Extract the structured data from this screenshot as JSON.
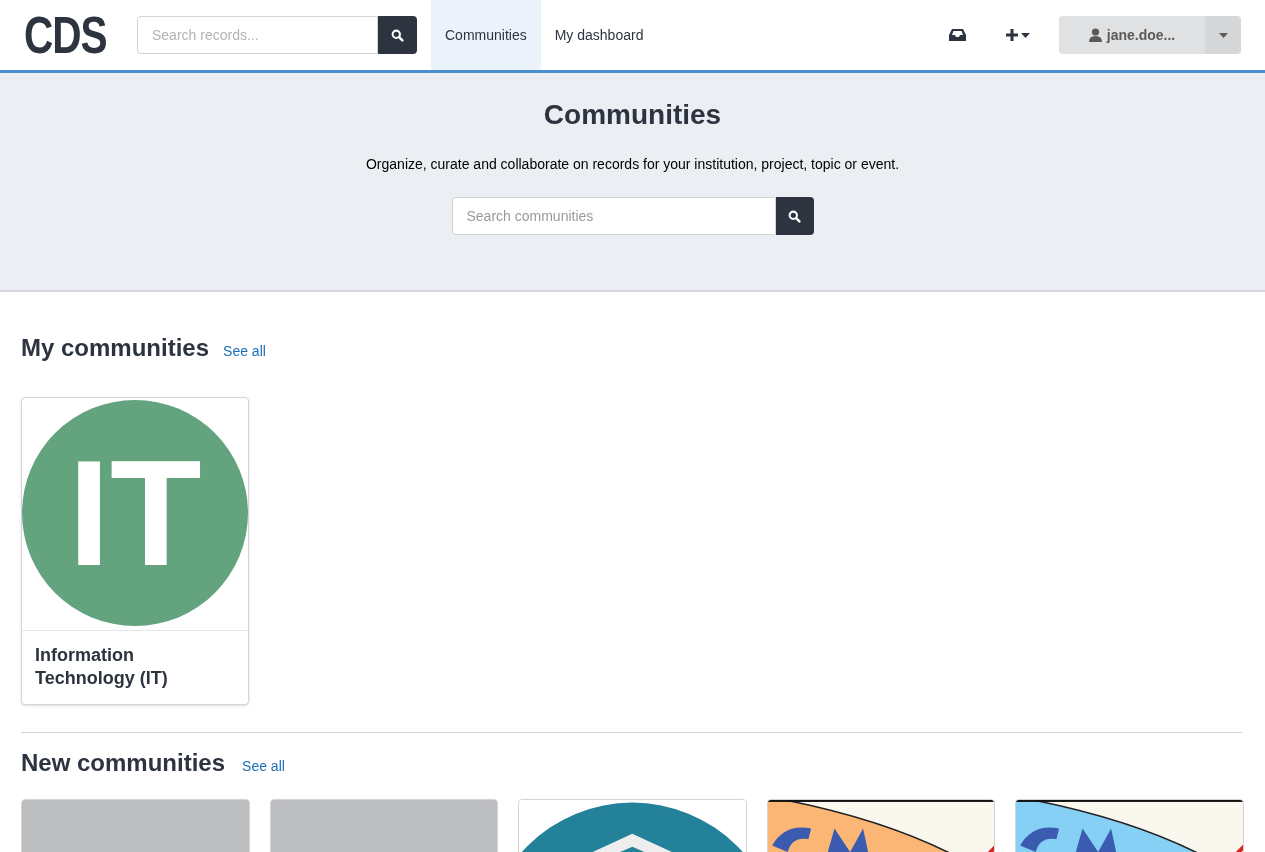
{
  "header": {
    "logo": "CDS",
    "search": {
      "placeholder": "Search records..."
    },
    "nav": [
      {
        "label": "Communities",
        "selected": true
      },
      {
        "label": "My dashboard",
        "selected": false
      }
    ],
    "user": {
      "name": "jane.doe..."
    }
  },
  "hero": {
    "title": "Communities",
    "subtitle": "Organize, curate and collaborate on records for your institution, project, topic or event.",
    "search": {
      "placeholder": "Search communities"
    }
  },
  "my_communities": {
    "title": "My communities",
    "link": "See all",
    "cards": [
      {
        "avatar": "IT",
        "color": "#63a47e",
        "name": "Information Technology (IT)"
      }
    ]
  },
  "new_communities": {
    "title": "New communities",
    "link": "See all",
    "cards": [
      {
        "kind": "placeholder"
      },
      {
        "kind": "placeholder"
      },
      {
        "kind": "teal-logo"
      },
      {
        "kind": "orange-logo"
      },
      {
        "kind": "blue-logo"
      }
    ]
  }
}
